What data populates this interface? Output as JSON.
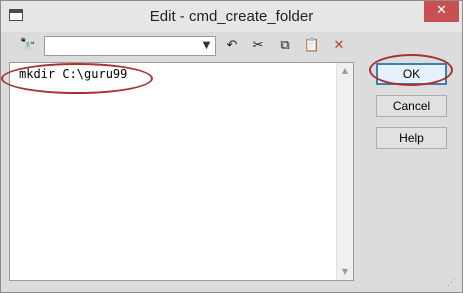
{
  "window": {
    "title": "Edit  - cmd_create_folder",
    "close_glyph": "✕"
  },
  "toolbar": {
    "icons": [
      {
        "name": "find-icon",
        "glyph": "🔭"
      },
      {
        "name": "undo-icon",
        "glyph": "↶"
      },
      {
        "name": "cut-icon",
        "glyph": "✂"
      },
      {
        "name": "copy-icon",
        "glyph": "⧉"
      },
      {
        "name": "paste-icon",
        "glyph": "📋"
      },
      {
        "name": "delete-icon",
        "glyph": "✕"
      }
    ],
    "find_value": "",
    "dropdown_glyph": "▼"
  },
  "editor": {
    "content": "mkdir C:\\guru99"
  },
  "buttons": {
    "ok": "OK",
    "cancel": "Cancel",
    "help": "Help"
  },
  "colors": {
    "annotation": "#a83232",
    "delete": "#c0392b"
  }
}
